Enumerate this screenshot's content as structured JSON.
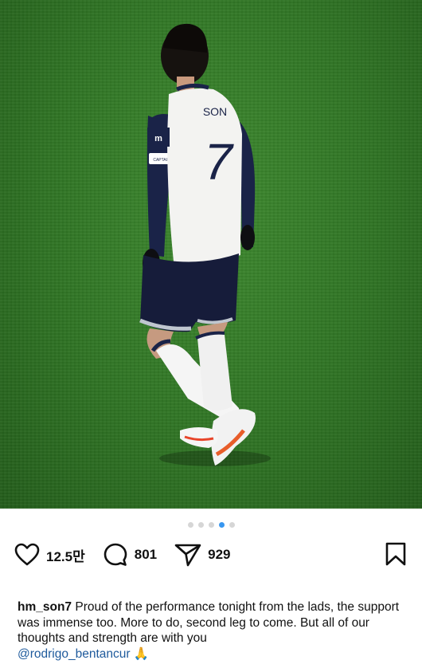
{
  "post": {
    "carousel": {
      "total": 5,
      "active_index": 3
    },
    "likes": "12.5만",
    "comments": "801",
    "shares": "929"
  },
  "caption": {
    "username": "hm_son7",
    "text": "Proud of the performance tonight from the lads, the support was immense too. More to do, second leg to come. But all of our thoughts and strength are with you",
    "mention": "@rodrigo_bentancur",
    "emoji": "🙏"
  },
  "image": {
    "shirt_name": "SON",
    "shirt_number": "7",
    "armband_text": "CAPTAIN"
  },
  "icons": {
    "like": "heart-icon",
    "comment": "comment-bubble-icon",
    "share": "paper-plane-icon",
    "save": "bookmark-icon"
  },
  "colors": {
    "active_dot": "#3897f0",
    "inactive_dot": "#d6d6d6",
    "mention": "#1e5a9c",
    "pitch": "#2f7424"
  }
}
